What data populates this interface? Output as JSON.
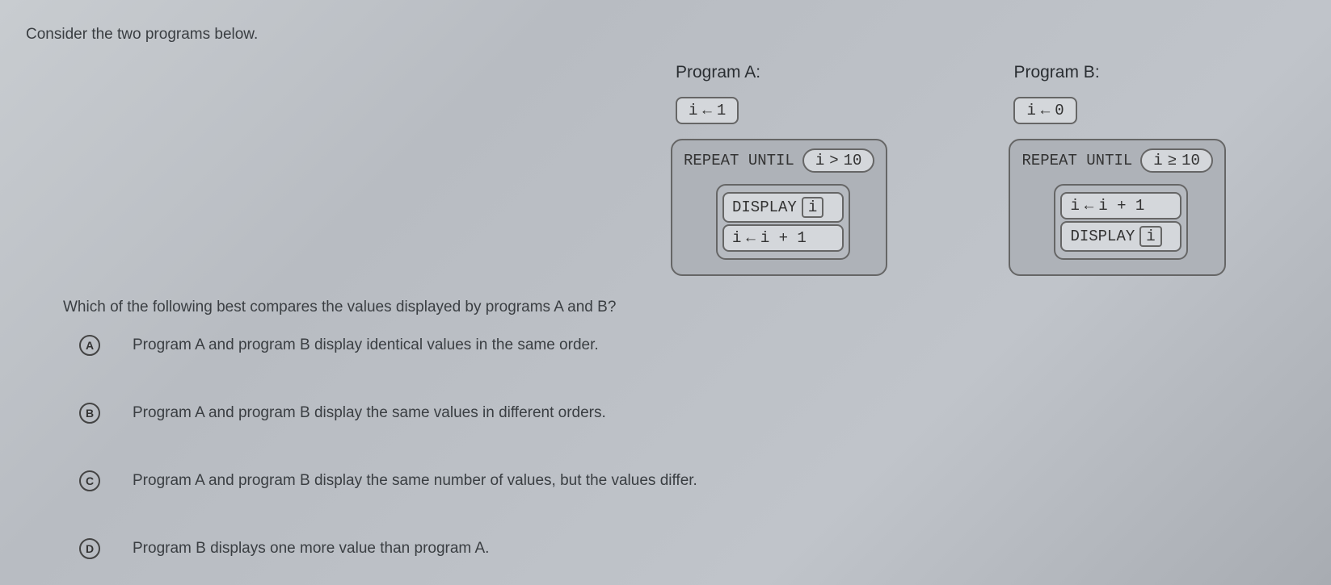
{
  "intro": "Consider the two programs below.",
  "question": "Which of the following best compares the values displayed by programs A and B?",
  "choices": [
    {
      "letter": "A",
      "text": "Program A and program B display identical values in the same order."
    },
    {
      "letter": "B",
      "text": "Program A and program B display the same values in different orders."
    },
    {
      "letter": "C",
      "text": "Program A and program B display the same number of values, but the values differ."
    },
    {
      "letter": "D",
      "text": "Program B displays one more value than program A."
    }
  ],
  "programA": {
    "title": "Program A:",
    "init_var": "i",
    "init_arrow": "←",
    "init_val": "1",
    "repeat_label": "REPEAT UNTIL",
    "cond_var": "i",
    "cond_op": ">",
    "cond_val": "10",
    "line1_label": "DISPLAY",
    "line1_var": "i",
    "line2_var": "i",
    "line2_arrow": "←",
    "line2_expr": "i + 1"
  },
  "programB": {
    "title": "Program B:",
    "init_var": "i",
    "init_arrow": "←",
    "init_val": "0",
    "repeat_label": "REPEAT UNTIL",
    "cond_var": "i",
    "cond_op": "≥",
    "cond_val": "10",
    "line1_var": "i",
    "line1_arrow": "←",
    "line1_expr": "i + 1",
    "line2_label": "DISPLAY",
    "line2_var": "i"
  }
}
